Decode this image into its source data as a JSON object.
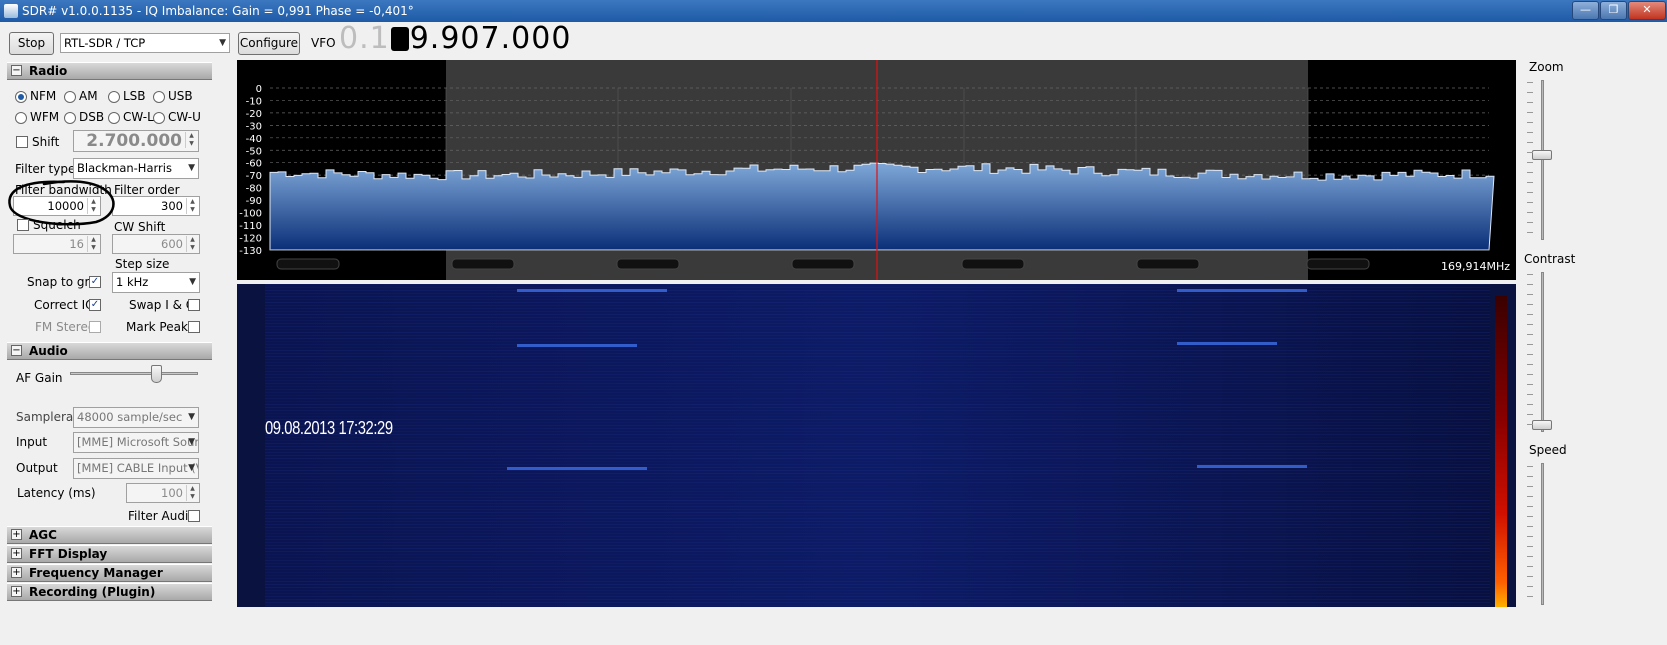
{
  "window": {
    "title": "SDR# v1.0.0.1135 - IQ Imbalance: Gain = 0,991 Phase = -0,401°",
    "min_icon": "minimize-icon",
    "max_icon": "maximize-icon",
    "close_icon": "close-icon"
  },
  "toolbar": {
    "stop_label": "Stop",
    "source_value": "RTL-SDR / TCP",
    "configure_label": "Configure",
    "vfo_label": "VFO",
    "vfo_dim": "0.1",
    "vfo_value": "9.907.000"
  },
  "radio": {
    "header": "Radio",
    "modes": [
      "NFM",
      "AM",
      "LSB",
      "USB",
      "WFM",
      "DSB",
      "CW-L",
      "CW-U"
    ],
    "selected_mode": "NFM",
    "shift_label": "Shift",
    "shift_value": "2.700.000",
    "filter_type_label": "Filter type",
    "filter_type_value": "Blackman-Harris",
    "filter_bandwidth_label": "Filter bandwidth",
    "filter_bandwidth_value": "10000",
    "filter_order_label": "Filter order",
    "filter_order_value": "300",
    "squelch_label": "Squelch",
    "squelch_value": "16",
    "cw_shift_label": "CW Shift",
    "cw_shift_value": "600",
    "step_size_label": "Step size",
    "step_size_value": "1 kHz",
    "snap_to_grid_label": "Snap to grid",
    "snap_to_grid_checked": true,
    "correct_iq_label": "Correct IQ",
    "correct_iq_checked": true,
    "swap_iq_label": "Swap I & Q",
    "fm_stereo_label": "FM Stereo",
    "mark_peaks_label": "Mark Peaks"
  },
  "audio": {
    "header": "Audio",
    "af_gain_label": "AF Gain",
    "af_gain_level": 0.68,
    "samplerate_label": "Samplerate",
    "samplerate_value": "48000 sample/sec",
    "input_label": "Input",
    "input_value": "[MME] Microsoft Sound",
    "output_label": "Output",
    "output_value": "[MME] CABLE Input (VI",
    "latency_label": "Latency (ms)",
    "latency_value": "100",
    "filter_audio_label": "Filter Audio"
  },
  "collapsed_panels": [
    "AGC",
    "FFT Display",
    "Frequency Manager (Plugin)",
    "Recording (Plugin)"
  ],
  "spectrum": {
    "y_ticks": [
      "0",
      "-10",
      "-20",
      "-30",
      "-40",
      "-50",
      "-60",
      "-70",
      "-80",
      "-90",
      "-100",
      "-110",
      "-120",
      "-130"
    ],
    "freq_right_label": "169,914MHz",
    "background": "#000000",
    "fill_color": "#1f5fb0",
    "center_marker_color": "#e01010"
  },
  "waterfall": {
    "timestamp": "09.08.2013 17:32:29"
  },
  "right_panel": {
    "zoom_label": "Zoom",
    "contrast_label": "Contrast",
    "speed_label": "Speed"
  }
}
